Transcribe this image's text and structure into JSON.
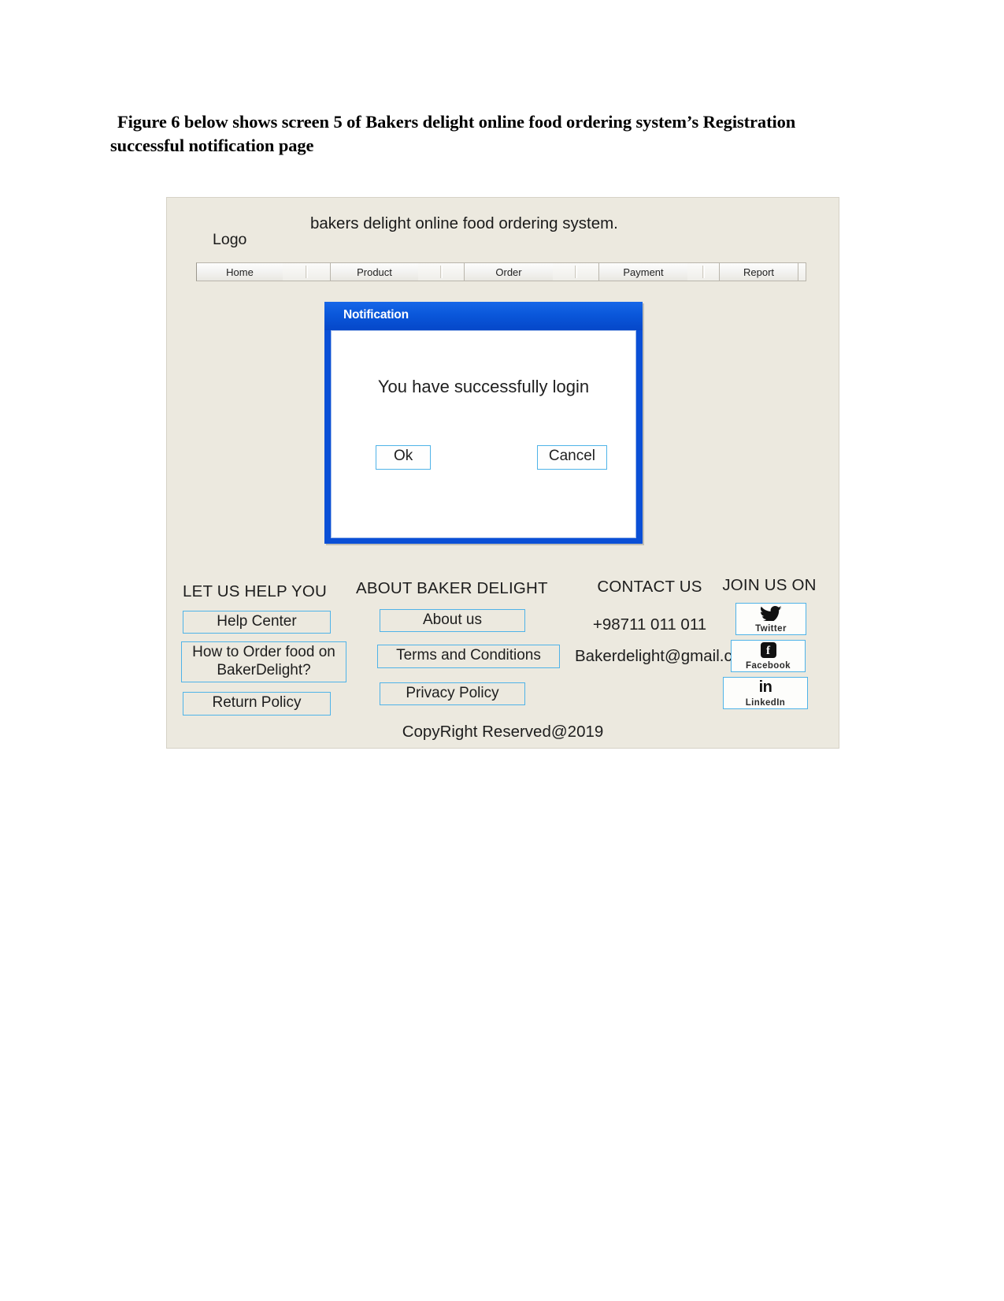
{
  "caption": {
    "line1": "Figure 6 below shows screen 5 of Bakers delight online food ordering system’s Registration",
    "line2": "successful notification page"
  },
  "mockup": {
    "header": {
      "logo_label": "Logo",
      "site_title": "bakers delight online food ordering system."
    },
    "nav": {
      "items": [
        {
          "label": "Home"
        },
        {
          "label": "Product"
        },
        {
          "label": "Order"
        },
        {
          "label": "Payment"
        },
        {
          "label": "Report"
        }
      ]
    },
    "dialog": {
      "title": "Notification",
      "message": "You have successfully login",
      "ok_label": "Ok",
      "cancel_label": "Cancel",
      "titlebar_color": "#0a57da",
      "border_color": "#0a4fd6",
      "button_border_color": "#4fb3e8"
    },
    "footer": {
      "help": {
        "heading": "LET US HELP YOU",
        "links": [
          "Help Center",
          "How to Order food on BakerDelight?",
          "Return Policy"
        ]
      },
      "about": {
        "heading": "ABOUT BAKER DELIGHT",
        "links": [
          "About us",
          "Terms and Conditions",
          "Privacy Policy"
        ]
      },
      "contact": {
        "heading": "CONTACT US",
        "phone": "+98711 011 011",
        "email": "Bakerdelight@gmail.com"
      },
      "social": {
        "heading": "JOIN US ON",
        "items": [
          {
            "name": "Twitter",
            "glyph": "twitter-icon"
          },
          {
            "name": "Facebook",
            "glyph": "facebook-icon"
          },
          {
            "name": "LinkedIn",
            "glyph": "linkedin-icon"
          }
        ]
      },
      "copyright": "CopyRight Reserved@2019"
    },
    "colors": {
      "page_background": "#ece9df",
      "accent_border": "#4fb3e8",
      "dialog_blue": "#0a57da"
    }
  }
}
